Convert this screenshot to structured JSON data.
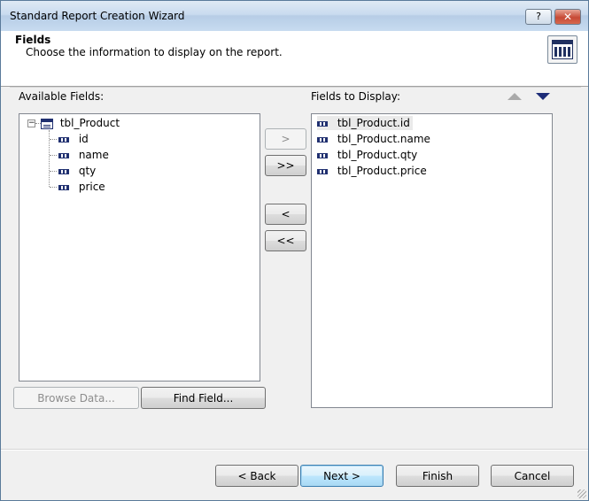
{
  "window": {
    "title": "Standard Report Creation Wizard",
    "help_glyph": "?",
    "close_glyph": "✕"
  },
  "header": {
    "title": "Fields",
    "subtitle": "Choose the information to display on the report."
  },
  "available": {
    "label": "Available Fields:",
    "table": "tbl_Product",
    "expander": "−",
    "fields": [
      "id",
      "name",
      "qty",
      "price"
    ]
  },
  "display": {
    "label": "Fields to Display:",
    "fields": [
      "tbl_Product.id",
      "tbl_Product.name",
      "tbl_Product.qty",
      "tbl_Product.price"
    ]
  },
  "transfer": {
    "add": ">",
    "add_all": ">>",
    "remove": "<",
    "remove_all": "<<"
  },
  "buttons": {
    "browse": "Browse Data...",
    "find": "Find Field...",
    "back": "< Back",
    "next": "Next >",
    "finish": "Finish",
    "cancel": "Cancel"
  }
}
